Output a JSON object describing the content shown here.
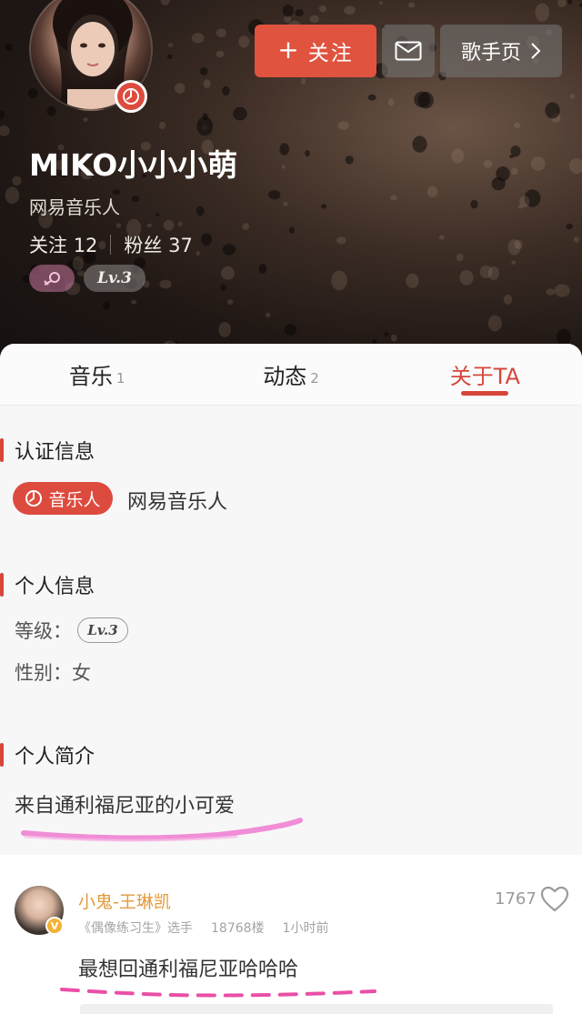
{
  "header": {
    "follow_label": "关注",
    "follow_icon": "plus-icon",
    "mail_icon": "mail-icon",
    "singer_page_label": "歌手页",
    "singer_page_icon": "chevron-right-icon",
    "username": "MIKO小小小萌",
    "subtitle": "网易音乐人",
    "following_label": "关注",
    "following_count": "12",
    "fans_label": "粉丝",
    "fans_count": "37",
    "gender_icon": "female-icon",
    "level_badge": "Lv.3"
  },
  "tabs": [
    {
      "label": "音乐",
      "count": "1",
      "active": false
    },
    {
      "label": "动态",
      "count": "2",
      "active": false
    },
    {
      "label": "关于TA",
      "count": "",
      "active": true
    }
  ],
  "about": {
    "cert_title": "认证信息",
    "cert_badge": "音乐人",
    "cert_text": "网易音乐人",
    "personal_title": "个人信息",
    "level_label": "等级：",
    "level_value": "Lv.3",
    "gender_line": "性别：女",
    "intro_title": "个人简介",
    "intro_text": "来自通利福尼亚的小可爱"
  },
  "comment": {
    "name": "小鬼-王琳凯",
    "tag": "《偶像练习生》选手",
    "floor": "18768楼",
    "time": "1小时前",
    "likes": "1767",
    "text": "最想回通利福尼亚哈哈哈"
  },
  "colors": {
    "accent": "#d7463a",
    "follow_button": "#e0533f",
    "commenter_name": "#e39a3c"
  }
}
